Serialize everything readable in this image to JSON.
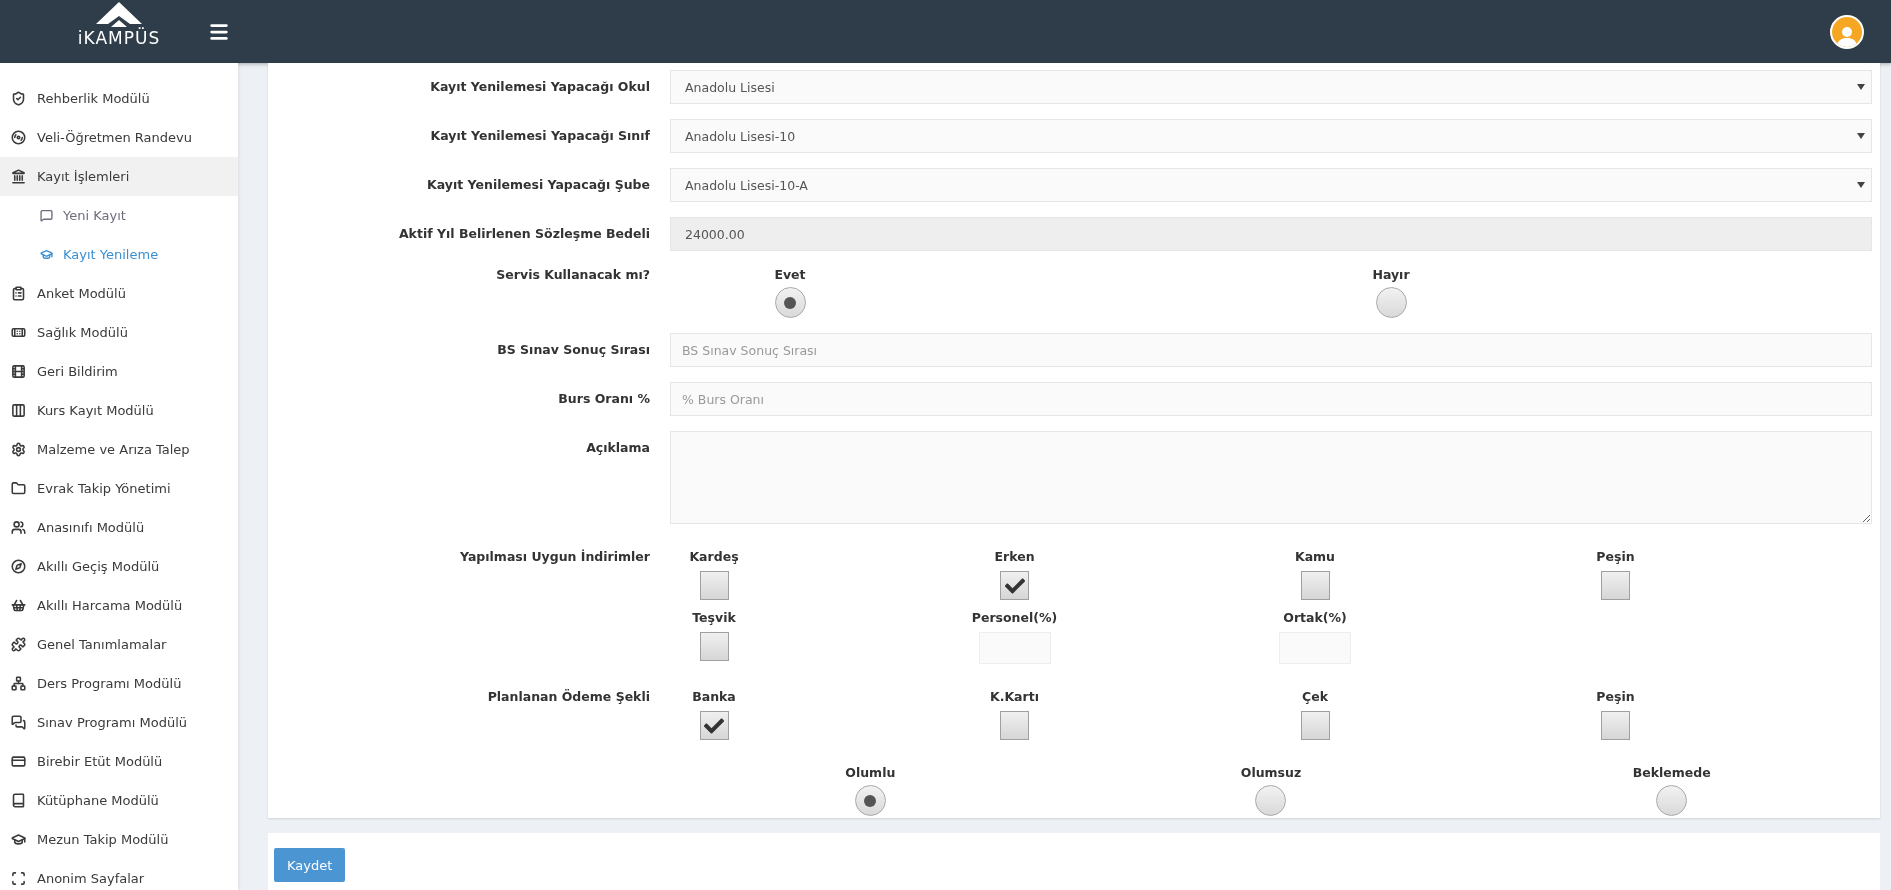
{
  "header": {
    "logo": "iKAMPÜS"
  },
  "sidebar": {
    "items": [
      {
        "label": "Rehberlik Modülü",
        "selected": false
      },
      {
        "label": "Veli-Öğretmen Randevu",
        "selected": false
      },
      {
        "label": "Kayıt İşlemleri",
        "selected": true,
        "children": [
          {
            "label": "Yeni Kayıt",
            "selected": false
          },
          {
            "label": "Kayıt Yenileme",
            "selected": true
          }
        ]
      },
      {
        "label": "Anket Modülü",
        "selected": false
      },
      {
        "label": "Sağlık Modülü",
        "selected": false
      },
      {
        "label": "Geri Bildirim",
        "selected": false
      },
      {
        "label": "Kurs Kayıt Modülü",
        "selected": false
      },
      {
        "label": "Malzeme ve Arıza Talep",
        "selected": false
      },
      {
        "label": "Evrak Takip Yönetimi",
        "selected": false
      },
      {
        "label": "Anasınıfı Modülü",
        "selected": false
      },
      {
        "label": "Akıllı Geçiş Modülü",
        "selected": false
      },
      {
        "label": "Akıllı Harcama Modülü",
        "selected": false
      },
      {
        "label": "Genel Tanımlamalar",
        "selected": false
      },
      {
        "label": "Ders Programı Modülü",
        "selected": false
      },
      {
        "label": "Sınav Programı Modülü",
        "selected": false
      },
      {
        "label": "Birebir Etüt Modülü",
        "selected": false
      },
      {
        "label": "Kütüphane Modülü",
        "selected": false
      },
      {
        "label": "Mezun Takip Modülü",
        "selected": false
      },
      {
        "label": "Anonim Sayfalar",
        "selected": false
      }
    ]
  },
  "form": {
    "fields": [
      {
        "kind": "select",
        "label": "Kayıt Yenilemesi Yapacağı Okul",
        "value": "Anadolu Lisesi"
      },
      {
        "kind": "select",
        "label": "Kayıt Yenilemesi Yapacağı Sınıf",
        "value": "Anadolu Lisesi-10"
      },
      {
        "kind": "select",
        "label": "Kayıt Yenilemesi Yapacağı Şube",
        "value": "Anadolu Lisesi-10-A"
      },
      {
        "kind": "readonly",
        "label": "Aktif Yıl Belirlenen Sözleşme Bedeli",
        "value": "24000.00"
      },
      {
        "kind": "radio",
        "label": "Servis Kullanacak mı?",
        "options": [
          {
            "label": "Evet",
            "selected": true
          },
          {
            "label": "Hayır",
            "selected": false
          }
        ]
      },
      {
        "kind": "text",
        "label": "BS Sınav Sonuç Sırası",
        "placeholder": "BS Sınav Sonuç Sırası"
      },
      {
        "kind": "text",
        "label": "Burs Oranı %",
        "placeholder": "% Burs Oranı"
      },
      {
        "kind": "textarea",
        "label": "Açıklama"
      },
      {
        "kind": "checkgrid",
        "label": "Yapılması Uygun İndirimler",
        "items": [
          {
            "kind": "checkbox",
            "label": "Kardeş",
            "checked": false
          },
          {
            "kind": "checkbox",
            "label": "Erken",
            "checked": true
          },
          {
            "kind": "checkbox",
            "label": "Kamu",
            "checked": false
          },
          {
            "kind": "checkbox",
            "label": "Peşin",
            "checked": false
          },
          {
            "kind": "checkbox",
            "label": "Teşvik",
            "checked": false
          },
          {
            "kind": "input",
            "label": "Personel(%)"
          },
          {
            "kind": "input",
            "label": "Ortak(%)"
          }
        ]
      },
      {
        "kind": "checkgrid",
        "label": "Planlanan Ödeme Şekli",
        "items": [
          {
            "kind": "checkbox",
            "label": "Banka",
            "checked": true
          },
          {
            "kind": "checkbox",
            "label": "K.Kartı",
            "checked": false
          },
          {
            "kind": "checkbox",
            "label": "Çek",
            "checked": false
          },
          {
            "kind": "checkbox",
            "label": "Peşin",
            "checked": false
          }
        ]
      },
      {
        "kind": "radio",
        "options": [
          {
            "label": "Olumlu",
            "selected": true
          },
          {
            "label": "Olumsuz",
            "selected": false
          },
          {
            "label": "Beklemede",
            "selected": false
          }
        ]
      }
    ],
    "submit": "Kaydet"
  }
}
